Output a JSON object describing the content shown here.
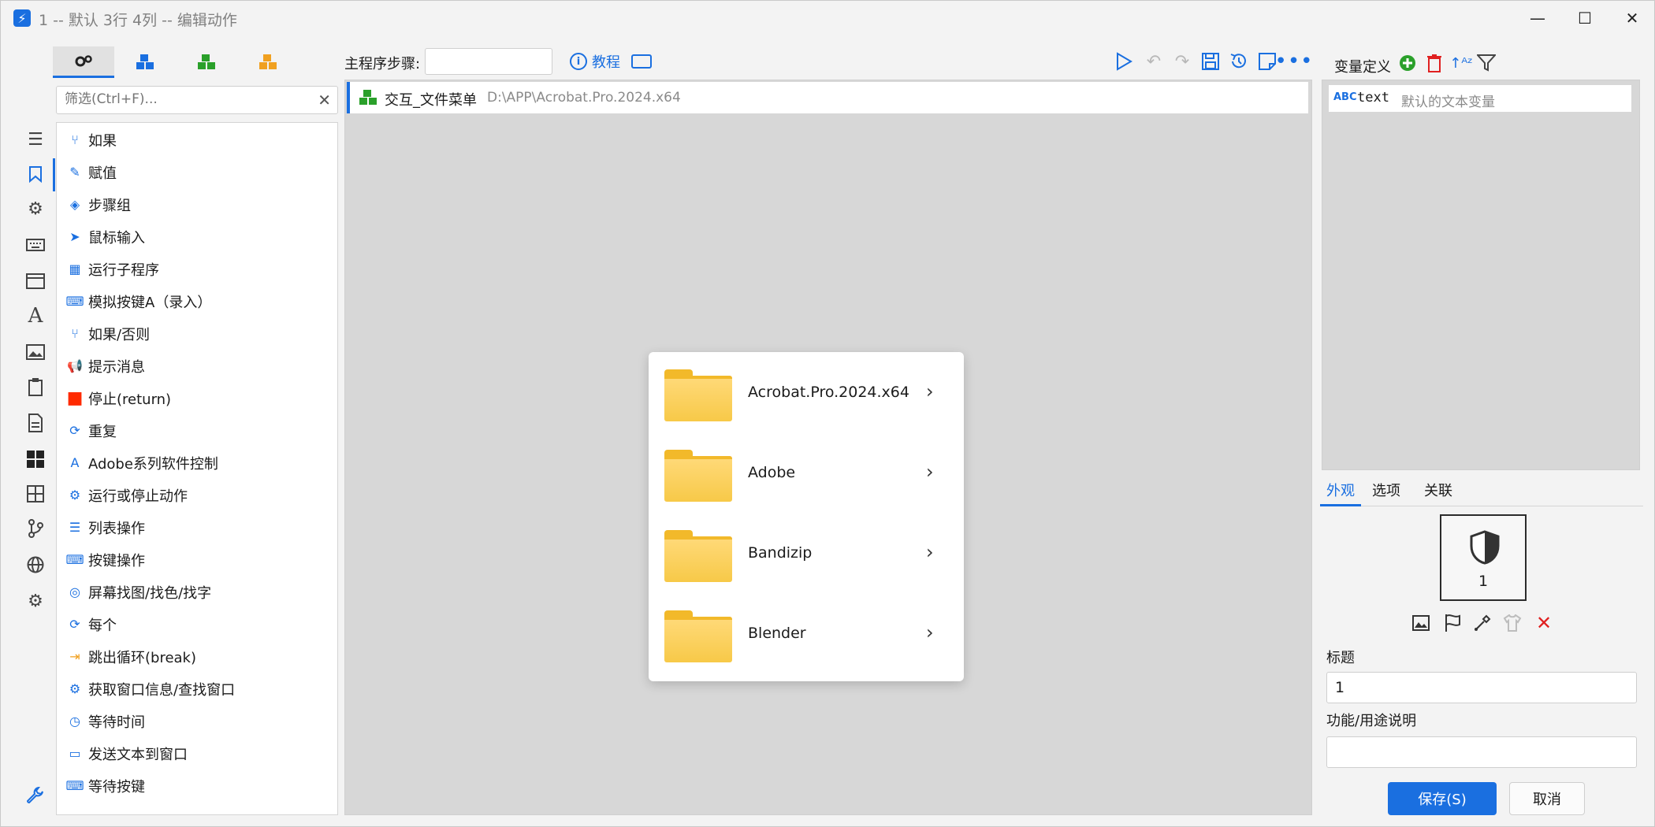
{
  "window": {
    "title": "1 -- 默认 3行 4列 -- 编辑动作",
    "minimize": "—",
    "maximize": "☐",
    "close": "✕"
  },
  "filter": {
    "placeholder": "筛选(Ctrl+F)...",
    "clear_icon": "close-icon"
  },
  "steps": [
    {
      "label": "如果",
      "icon": "branch-icon"
    },
    {
      "label": "赋值",
      "icon": "edit-icon"
    },
    {
      "label": "步骤组",
      "icon": "layers-icon"
    },
    {
      "label": "鼠标输入",
      "icon": "cursor-icon"
    },
    {
      "label": "运行子程序",
      "icon": "cubes-icon"
    },
    {
      "label": "模拟按键A（录入）",
      "icon": "keyboard-icon"
    },
    {
      "label": "如果/否则",
      "icon": "branch-icon"
    },
    {
      "label": "提示消息",
      "icon": "megaphone-icon"
    },
    {
      "label": "停止(return)",
      "icon": "stop-icon"
    },
    {
      "label": "重复",
      "icon": "repeat-icon"
    },
    {
      "label": "Adobe系列软件控制",
      "icon": "adobe-icon"
    },
    {
      "label": "运行或停止动作",
      "icon": "gear-icon"
    },
    {
      "label": "列表操作",
      "icon": "list-icon"
    },
    {
      "label": "按键操作",
      "icon": "keyboard-icon"
    },
    {
      "label": "屏幕找图/找色/找字",
      "icon": "location-icon"
    },
    {
      "label": "每个",
      "icon": "repeat-icon"
    },
    {
      "label": "跳出循环(break)",
      "icon": "exit-icon"
    },
    {
      "label": "获取窗口信息/查找窗口",
      "icon": "gear-icon"
    },
    {
      "label": "等待时间",
      "icon": "timer-icon"
    },
    {
      "label": "发送文本到窗口",
      "icon": "message-icon"
    },
    {
      "label": "等待按键",
      "icon": "keyboard-icon"
    }
  ],
  "toolbar": {
    "main_steps_label": "主程序步骤:",
    "tutorial": "教程"
  },
  "main": {
    "step_name": "交互_文件菜单",
    "step_path": "D:\\APP\\Acrobat.Pro.2024.x64"
  },
  "popup": {
    "folders": [
      "Acrobat.Pro.2024.x64",
      "Adobe",
      "Bandizip",
      "Blender"
    ]
  },
  "right": {
    "var_title": "变量定义",
    "var_type": "ABC",
    "var_name": "text",
    "var_desc": "默认的文本变量",
    "tabs": [
      "外观",
      "选项",
      "关联"
    ],
    "badge_number": "1",
    "title_label": "标题",
    "title_value": "1",
    "desc_label": "功能/用途说明",
    "desc_value": "",
    "save": "保存(S)",
    "cancel": "取消"
  },
  "colors": {
    "accent": "#1a6fe0",
    "danger": "#e02020",
    "green": "#2aa02a"
  }
}
